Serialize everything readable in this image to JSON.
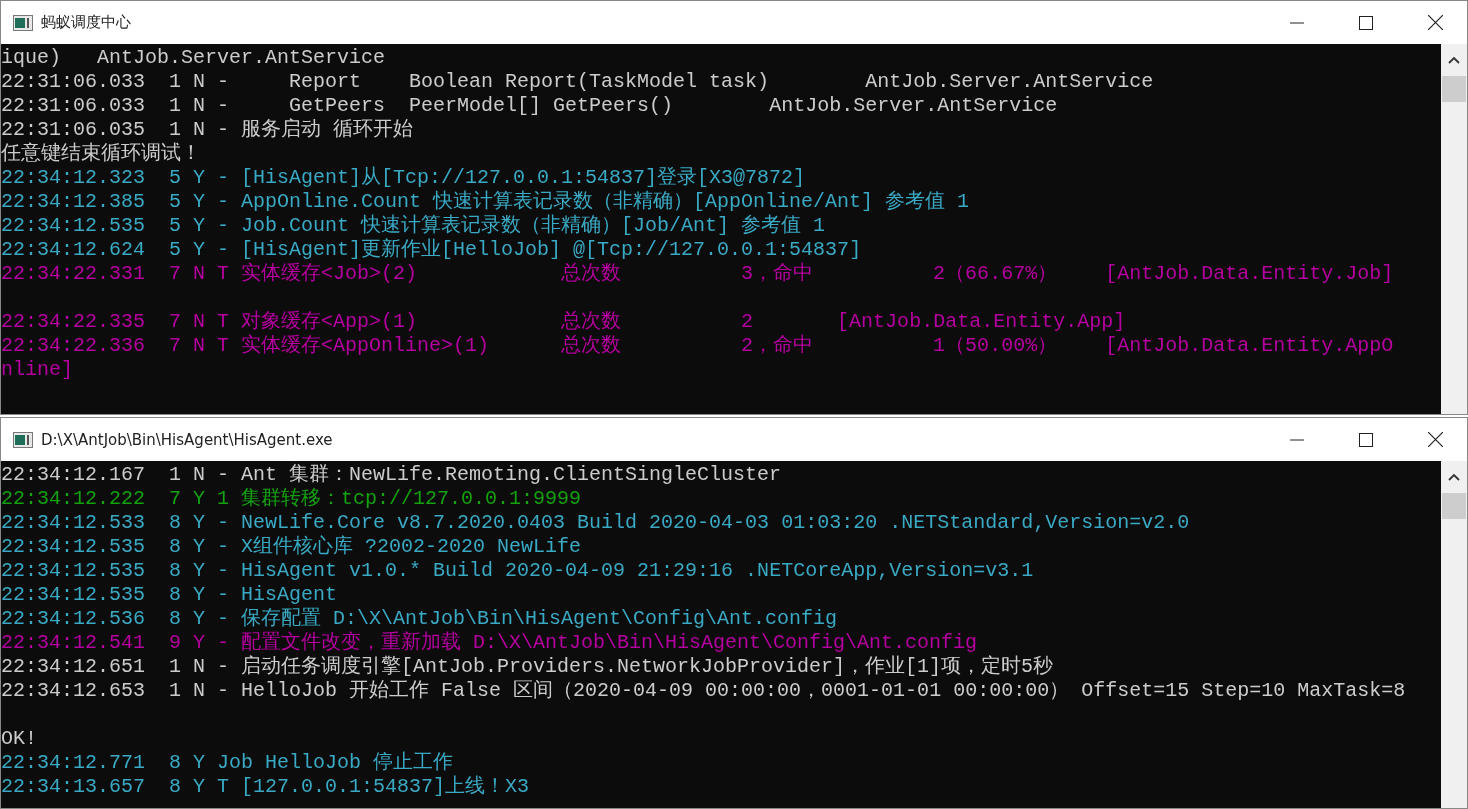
{
  "windows": [
    {
      "title": "蚂蚁调度中心",
      "lines": [
        {
          "text": "ique)   AntJob.Server.AntService",
          "color": "#cccccc"
        },
        {
          "text": "22:31:06.033  1 N -     Report    Boolean Report(TaskModel task)        AntJob.Server.AntService",
          "color": "#cccccc"
        },
        {
          "text": "22:31:06.033  1 N -     GetPeers  PeerModel[] GetPeers()        AntJob.Server.AntService",
          "color": "#cccccc"
        },
        {
          "text": "22:31:06.035  1 N - 服务启动 循环开始",
          "color": "#cccccc"
        },
        {
          "text": "任意键结束循环调试！",
          "color": "#cccccc"
        },
        {
          "text": "22:34:12.323  5 Y - [HisAgent]从[Tcp://127.0.0.1:54837]登录[X3@7872]",
          "color": "#3aa9c4"
        },
        {
          "text": "22:34:12.385  5 Y - AppOnline.Count 快速计算表记录数（非精确）[AppOnline/Ant] 参考值 1",
          "color": "#3aa9c4"
        },
        {
          "text": "22:34:12.535  5 Y - Job.Count 快速计算表记录数（非精确）[Job/Ant] 参考值 1",
          "color": "#3aa9c4"
        },
        {
          "text": "22:34:12.624  5 Y - [HisAgent]更新作业[HelloJob] @[Tcp://127.0.0.1:54837]",
          "color": "#3aa9c4"
        },
        {
          "text": "22:34:22.331  7 N T 实体缓存<Job>(2)            总次数          3，命中          2（66.67%）    [AntJob.Data.Entity.Job]",
          "color": "#b4009e",
          "trailing_blank": true
        },
        {
          "text": "22:34:22.335  7 N T 对象缓存<App>(1)            总次数          2       [AntJob.Data.Entity.App]",
          "color": "#b4009e"
        },
        {
          "text": "22:34:22.336  7 N T 实体缓存<AppOnline>(1)      总次数          2，命中          1（50.00%）    [AntJob.Data.Entity.AppO",
          "color": "#b4009e"
        },
        {
          "text": "nline]",
          "color": "#b4009e"
        }
      ]
    },
    {
      "title": "D:\\X\\AntJob\\Bin\\HisAgent\\HisAgent.exe",
      "lines": [
        {
          "text": "22:34:12.167  1 N - Ant 集群：NewLife.Remoting.ClientSingleCluster",
          "color": "#cccccc"
        },
        {
          "text": "22:34:12.222  7 Y 1 集群转移：tcp://127.0.0.1:9999",
          "color": "#13a10e"
        },
        {
          "text": "22:34:12.533  8 Y - NewLife.Core v8.7.2020.0403 Build 2020-04-03 01:03:20 .NETStandard,Version=v2.0",
          "color": "#3aa9c4"
        },
        {
          "text": "22:34:12.535  8 Y - X组件核心库 ?2002-2020 NewLife",
          "color": "#3aa9c4"
        },
        {
          "text": "22:34:12.535  8 Y - HisAgent v1.0.* Build 2020-04-09 21:29:16 .NETCoreApp,Version=v3.1",
          "color": "#3aa9c4"
        },
        {
          "text": "22:34:12.535  8 Y - HisAgent",
          "color": "#3aa9c4"
        },
        {
          "text": "22:34:12.536  8 Y - 保存配置 D:\\X\\AntJob\\Bin\\HisAgent\\Config\\Ant.config",
          "color": "#3aa9c4"
        },
        {
          "text": "22:34:12.541  9 Y - 配置文件改变，重新加载 D:\\X\\AntJob\\Bin\\HisAgent\\Config\\Ant.config",
          "color": "#b4009e"
        },
        {
          "text": "22:34:12.651  1 N - 启动任务调度引擎[AntJob.Providers.NetworkJobProvider]，作业[1]项，定时5秒",
          "color": "#cccccc"
        },
        {
          "text": "22:34:12.653  1 N - HelloJob 开始工作 False 区间（2020-04-09 00:00:00，0001-01-01 00:00:00） Offset=15 Step=10 MaxTask=8",
          "color": "#cccccc",
          "trailing_blank": true
        },
        {
          "text": "OK!",
          "color": "#cccccc"
        },
        {
          "text": "22:34:12.771  8 Y Job HelloJob 停止工作",
          "color": "#3aa9c4"
        },
        {
          "text": "22:34:13.657  8 Y T [127.0.0.1:54837]上线！X3",
          "color": "#3aa9c4"
        }
      ]
    }
  ]
}
